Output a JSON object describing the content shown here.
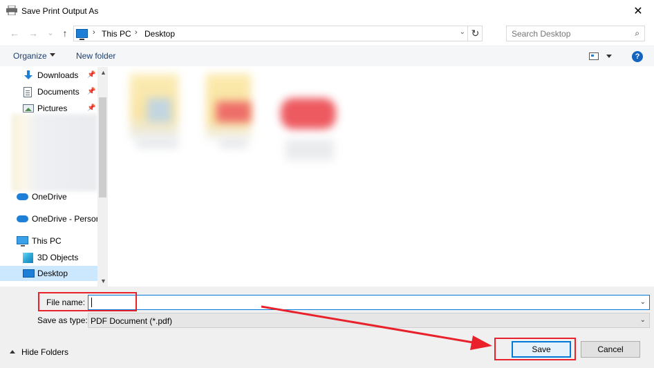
{
  "window": {
    "title": "Save Print Output As",
    "close_glyph": "✕"
  },
  "nav": {
    "back_glyph": "←",
    "forward_glyph": "→",
    "recent_glyph": "⌄",
    "up_glyph": "↑",
    "breadcrumb": [
      "This PC",
      "Desktop"
    ],
    "breadcrumb_sep": "›",
    "address_chevron": "⌄",
    "refresh_glyph": "↻",
    "search_placeholder": "Search Desktop",
    "search_glyph": "⌕"
  },
  "toolbar": {
    "organize": "Organize",
    "new_folder": "New folder",
    "help_glyph": "?"
  },
  "sidebar": {
    "pin_glyph": "📌",
    "items": [
      {
        "label": "Downloads",
        "icon": "downloads-icon",
        "pinned": true
      },
      {
        "label": "Documents",
        "icon": "documents-icon",
        "pinned": true
      },
      {
        "label": "Pictures",
        "icon": "pictures-icon",
        "pinned": true
      },
      {
        "label": "OneDrive",
        "icon": "onedrive-icon"
      },
      {
        "label": "OneDrive - Persor",
        "icon": "onedrive-icon"
      },
      {
        "label": "This PC",
        "icon": "this-pc-icon"
      },
      {
        "label": "3D Objects",
        "icon": "3d-objects-icon"
      },
      {
        "label": "Desktop",
        "icon": "desktop-icon",
        "selected": true
      }
    ],
    "scroll_up_glyph": "▲",
    "scroll_down_glyph": "▼"
  },
  "form": {
    "file_name_label": "File name:",
    "file_name_value": "",
    "save_as_type_label": "Save as type:",
    "save_as_type_value": "PDF Document (*.pdf)",
    "dropdown_glyph": "⌄"
  },
  "footer": {
    "hide_folders": "Hide Folders",
    "save": "Save",
    "cancel": "Cancel"
  },
  "colors": {
    "annotation_red": "#e8212a",
    "accent": "#0078d7",
    "selected_bg": "#cce8ff"
  }
}
